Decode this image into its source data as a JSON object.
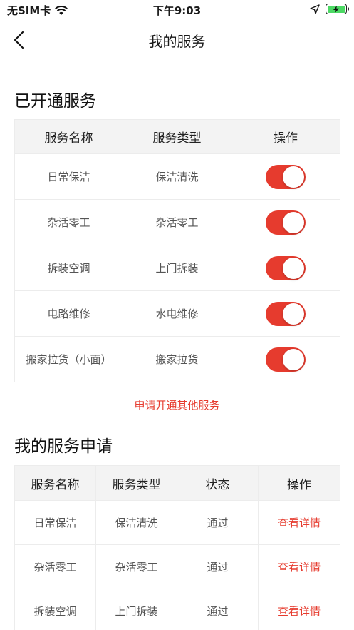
{
  "status_bar": {
    "carrier": "无SIM卡",
    "time": "下午9:03",
    "battery_color": "#4cd964"
  },
  "nav": {
    "title": "我的服务"
  },
  "opened_services": {
    "title": "已开通服务",
    "headers": [
      "服务名称",
      "服务类型",
      "操作"
    ],
    "rows": [
      {
        "name": "日常保洁",
        "type": "保洁清洗",
        "enabled": true
      },
      {
        "name": "杂活零工",
        "type": "杂活零工",
        "enabled": true
      },
      {
        "name": "拆装空调",
        "type": "上门拆装",
        "enabled": true
      },
      {
        "name": "电路维修",
        "type": "水电维修",
        "enabled": true
      },
      {
        "name": "搬家拉货（小面）",
        "type": "搬家拉货",
        "enabled": true
      }
    ],
    "apply_link": "申请开通其他服务"
  },
  "applications": {
    "title": "我的服务申请",
    "headers": [
      "服务名称",
      "服务类型",
      "状态",
      "操作"
    ],
    "rows": [
      {
        "name": "日常保洁",
        "type": "保洁清洗",
        "status": "通过",
        "action": "查看详情"
      },
      {
        "name": "杂活零工",
        "type": "杂活零工",
        "status": "通过",
        "action": "查看详情"
      },
      {
        "name": "拆装空调",
        "type": "上门拆装",
        "status": "通过",
        "action": "查看详情"
      }
    ]
  },
  "colors": {
    "accent": "#e63b2e",
    "header_bg": "#f3f3f3"
  },
  "icons": [
    "wifi-icon",
    "location-icon",
    "battery-charging-icon",
    "back-chevron-icon"
  ]
}
